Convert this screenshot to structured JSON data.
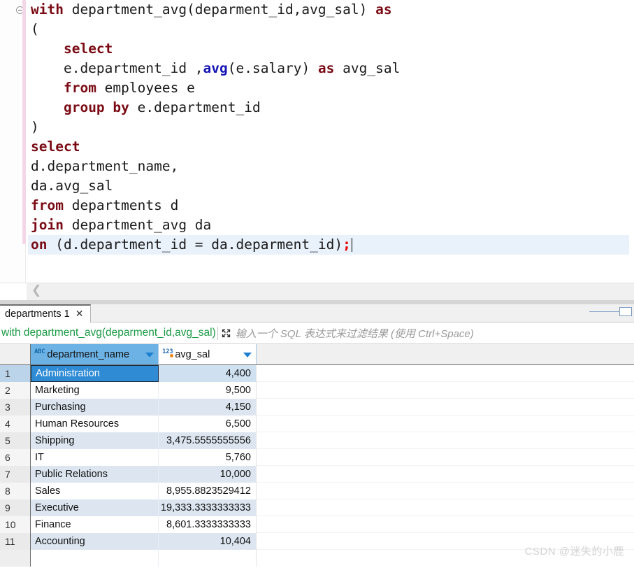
{
  "editor": {
    "lines": [
      [
        {
          "t": "with ",
          "c": "kw"
        },
        {
          "t": "department_avg(deparment_id,avg_sal) ",
          "c": ""
        },
        {
          "t": "as",
          "c": "kw"
        }
      ],
      [
        {
          "t": "(",
          "c": ""
        }
      ],
      [
        {
          "t": "    ",
          "c": ""
        },
        {
          "t": "select",
          "c": "kw"
        }
      ],
      [
        {
          "t": "    e.department_id ,",
          "c": ""
        },
        {
          "t": "avg",
          "c": "fn"
        },
        {
          "t": "(e.salary) ",
          "c": ""
        },
        {
          "t": "as",
          "c": "kw"
        },
        {
          "t": " avg_sal",
          "c": ""
        }
      ],
      [
        {
          "t": "    ",
          "c": ""
        },
        {
          "t": "from",
          "c": "kw"
        },
        {
          "t": " employees e",
          "c": ""
        }
      ],
      [
        {
          "t": "    ",
          "c": ""
        },
        {
          "t": "group by",
          "c": "kw"
        },
        {
          "t": " e.department_id",
          "c": ""
        }
      ],
      [
        {
          "t": ")",
          "c": ""
        }
      ],
      [
        {
          "t": "select",
          "c": "kw"
        }
      ],
      [
        {
          "t": "d.department_name,",
          "c": ""
        }
      ],
      [
        {
          "t": "da.avg_sal",
          "c": ""
        }
      ],
      [
        {
          "t": "from",
          "c": "kw"
        },
        {
          "t": " departments d",
          "c": ""
        }
      ],
      [
        {
          "t": "join",
          "c": "kw"
        },
        {
          "t": " department_avg da",
          "c": ""
        }
      ],
      [
        {
          "t": "on",
          "c": "kw"
        },
        {
          "t": " (d.department_id = da.deparment_id)",
          "c": ""
        },
        {
          "t": ";",
          "c": "semi"
        }
      ]
    ],
    "current_line_index": 12,
    "fold_icon": "fold-collapse-icon",
    "scroll_left_icon": "chevron-left-icon"
  },
  "results_tab": {
    "label": "departments 1",
    "close_icon": "close-icon",
    "maximize_icon": "maximize-panel-icon"
  },
  "filter": {
    "sql_text": "with department_avg(deparment_id,avg_sal)",
    "expand_icon": "expand-arrows-icon",
    "placeholder": "输入一个 SQL 表达式来过滤结果 (使用 Ctrl+Space)"
  },
  "grid": {
    "columns": [
      {
        "name": "department_name",
        "type_icon": "abc",
        "type_label": "ABC",
        "sort_icon": "filter-caret-icon",
        "selected": true
      },
      {
        "name": "avg_sal",
        "type_icon": "123",
        "type_label": "123",
        "sort_icon": "filter-caret-icon",
        "selected": false
      }
    ],
    "rows": [
      {
        "n": "1",
        "department_name": "Administration",
        "avg_sal": "4,400"
      },
      {
        "n": "2",
        "department_name": "Marketing",
        "avg_sal": "9,500"
      },
      {
        "n": "3",
        "department_name": "Purchasing",
        "avg_sal": "4,150"
      },
      {
        "n": "4",
        "department_name": "Human Resources",
        "avg_sal": "6,500"
      },
      {
        "n": "5",
        "department_name": "Shipping",
        "avg_sal": "3,475.5555555556"
      },
      {
        "n": "6",
        "department_name": "IT",
        "avg_sal": "5,760"
      },
      {
        "n": "7",
        "department_name": "Public Relations",
        "avg_sal": "10,000"
      },
      {
        "n": "8",
        "department_name": "Sales",
        "avg_sal": "8,955.8823529412"
      },
      {
        "n": "9",
        "department_name": "Executive",
        "avg_sal": "19,333.3333333333"
      },
      {
        "n": "10",
        "department_name": "Finance",
        "avg_sal": "8,601.3333333333"
      },
      {
        "n": "11",
        "department_name": "Accounting",
        "avg_sal": "10,404"
      }
    ],
    "selected_row_index": 0,
    "selected_column": "department_name"
  },
  "watermark": {
    "text": "CSDN @迷失的小鹿"
  },
  "colors": {
    "keyword": "#7a0b14",
    "function": "#1414b4",
    "semicolon": "#e60000",
    "filter_sql": "#1a9a45",
    "header_selected": "#6cb2e4",
    "cell_selected": "#2e8bd4",
    "row_alt": "#dde6f0",
    "change_bar": "#f3d7e6"
  }
}
